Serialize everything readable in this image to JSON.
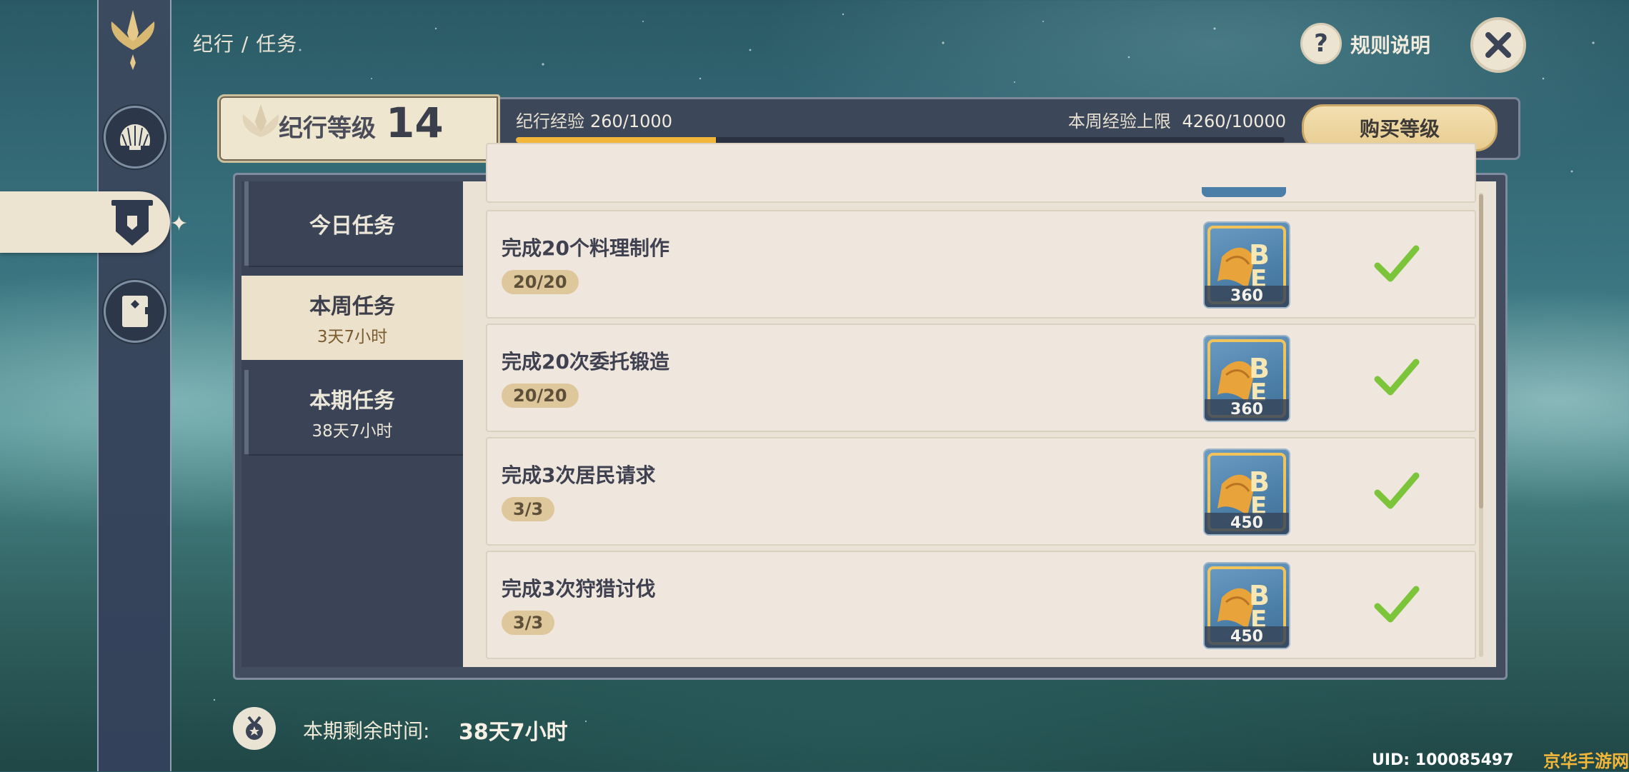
{
  "breadcrumb": "纪行 / 任务",
  "header": {
    "help_label": "规则说明"
  },
  "level": {
    "label": "纪行等级",
    "value": "14",
    "exp_label": "纪行经验",
    "exp_value": "260/1000",
    "exp_fraction": 0.26,
    "weekly_label": "本周经验上限",
    "weekly_value": "4260/10000",
    "buy_label": "购买等级"
  },
  "tabs": [
    {
      "title": "今日任务",
      "subtitle": ""
    },
    {
      "title": "本周任务",
      "subtitle": "3天7小时"
    },
    {
      "title": "本期任务",
      "subtitle": "38天7小时"
    }
  ],
  "tasks": [
    {
      "title": "完成20个料理制作",
      "progress": "20/20",
      "reward": "360",
      "completed": true
    },
    {
      "title": "完成20次委托锻造",
      "progress": "20/20",
      "reward": "360",
      "completed": true
    },
    {
      "title": "完成3次居民请求",
      "progress": "3/3",
      "reward": "450",
      "completed": true
    },
    {
      "title": "完成3次狩猎讨伐",
      "progress": "3/3",
      "reward": "450",
      "completed": true
    }
  ],
  "footer": {
    "remaining_label": "本期剩余时间:",
    "remaining_value": "38天7小时",
    "uid": "UID: 100085497",
    "watermark": "京华手游网"
  },
  "colors": {
    "accent_gold": "#f1b63a",
    "check_green": "#7cc43a",
    "panel_dark": "#434d60",
    "card_light": "#efe7dd"
  },
  "icons": [
    "emblem-icon",
    "shell-icon",
    "banner-icon",
    "notebook-icon",
    "help-icon",
    "close-icon",
    "reward-book-icon",
    "check-icon",
    "medal-icon"
  ]
}
